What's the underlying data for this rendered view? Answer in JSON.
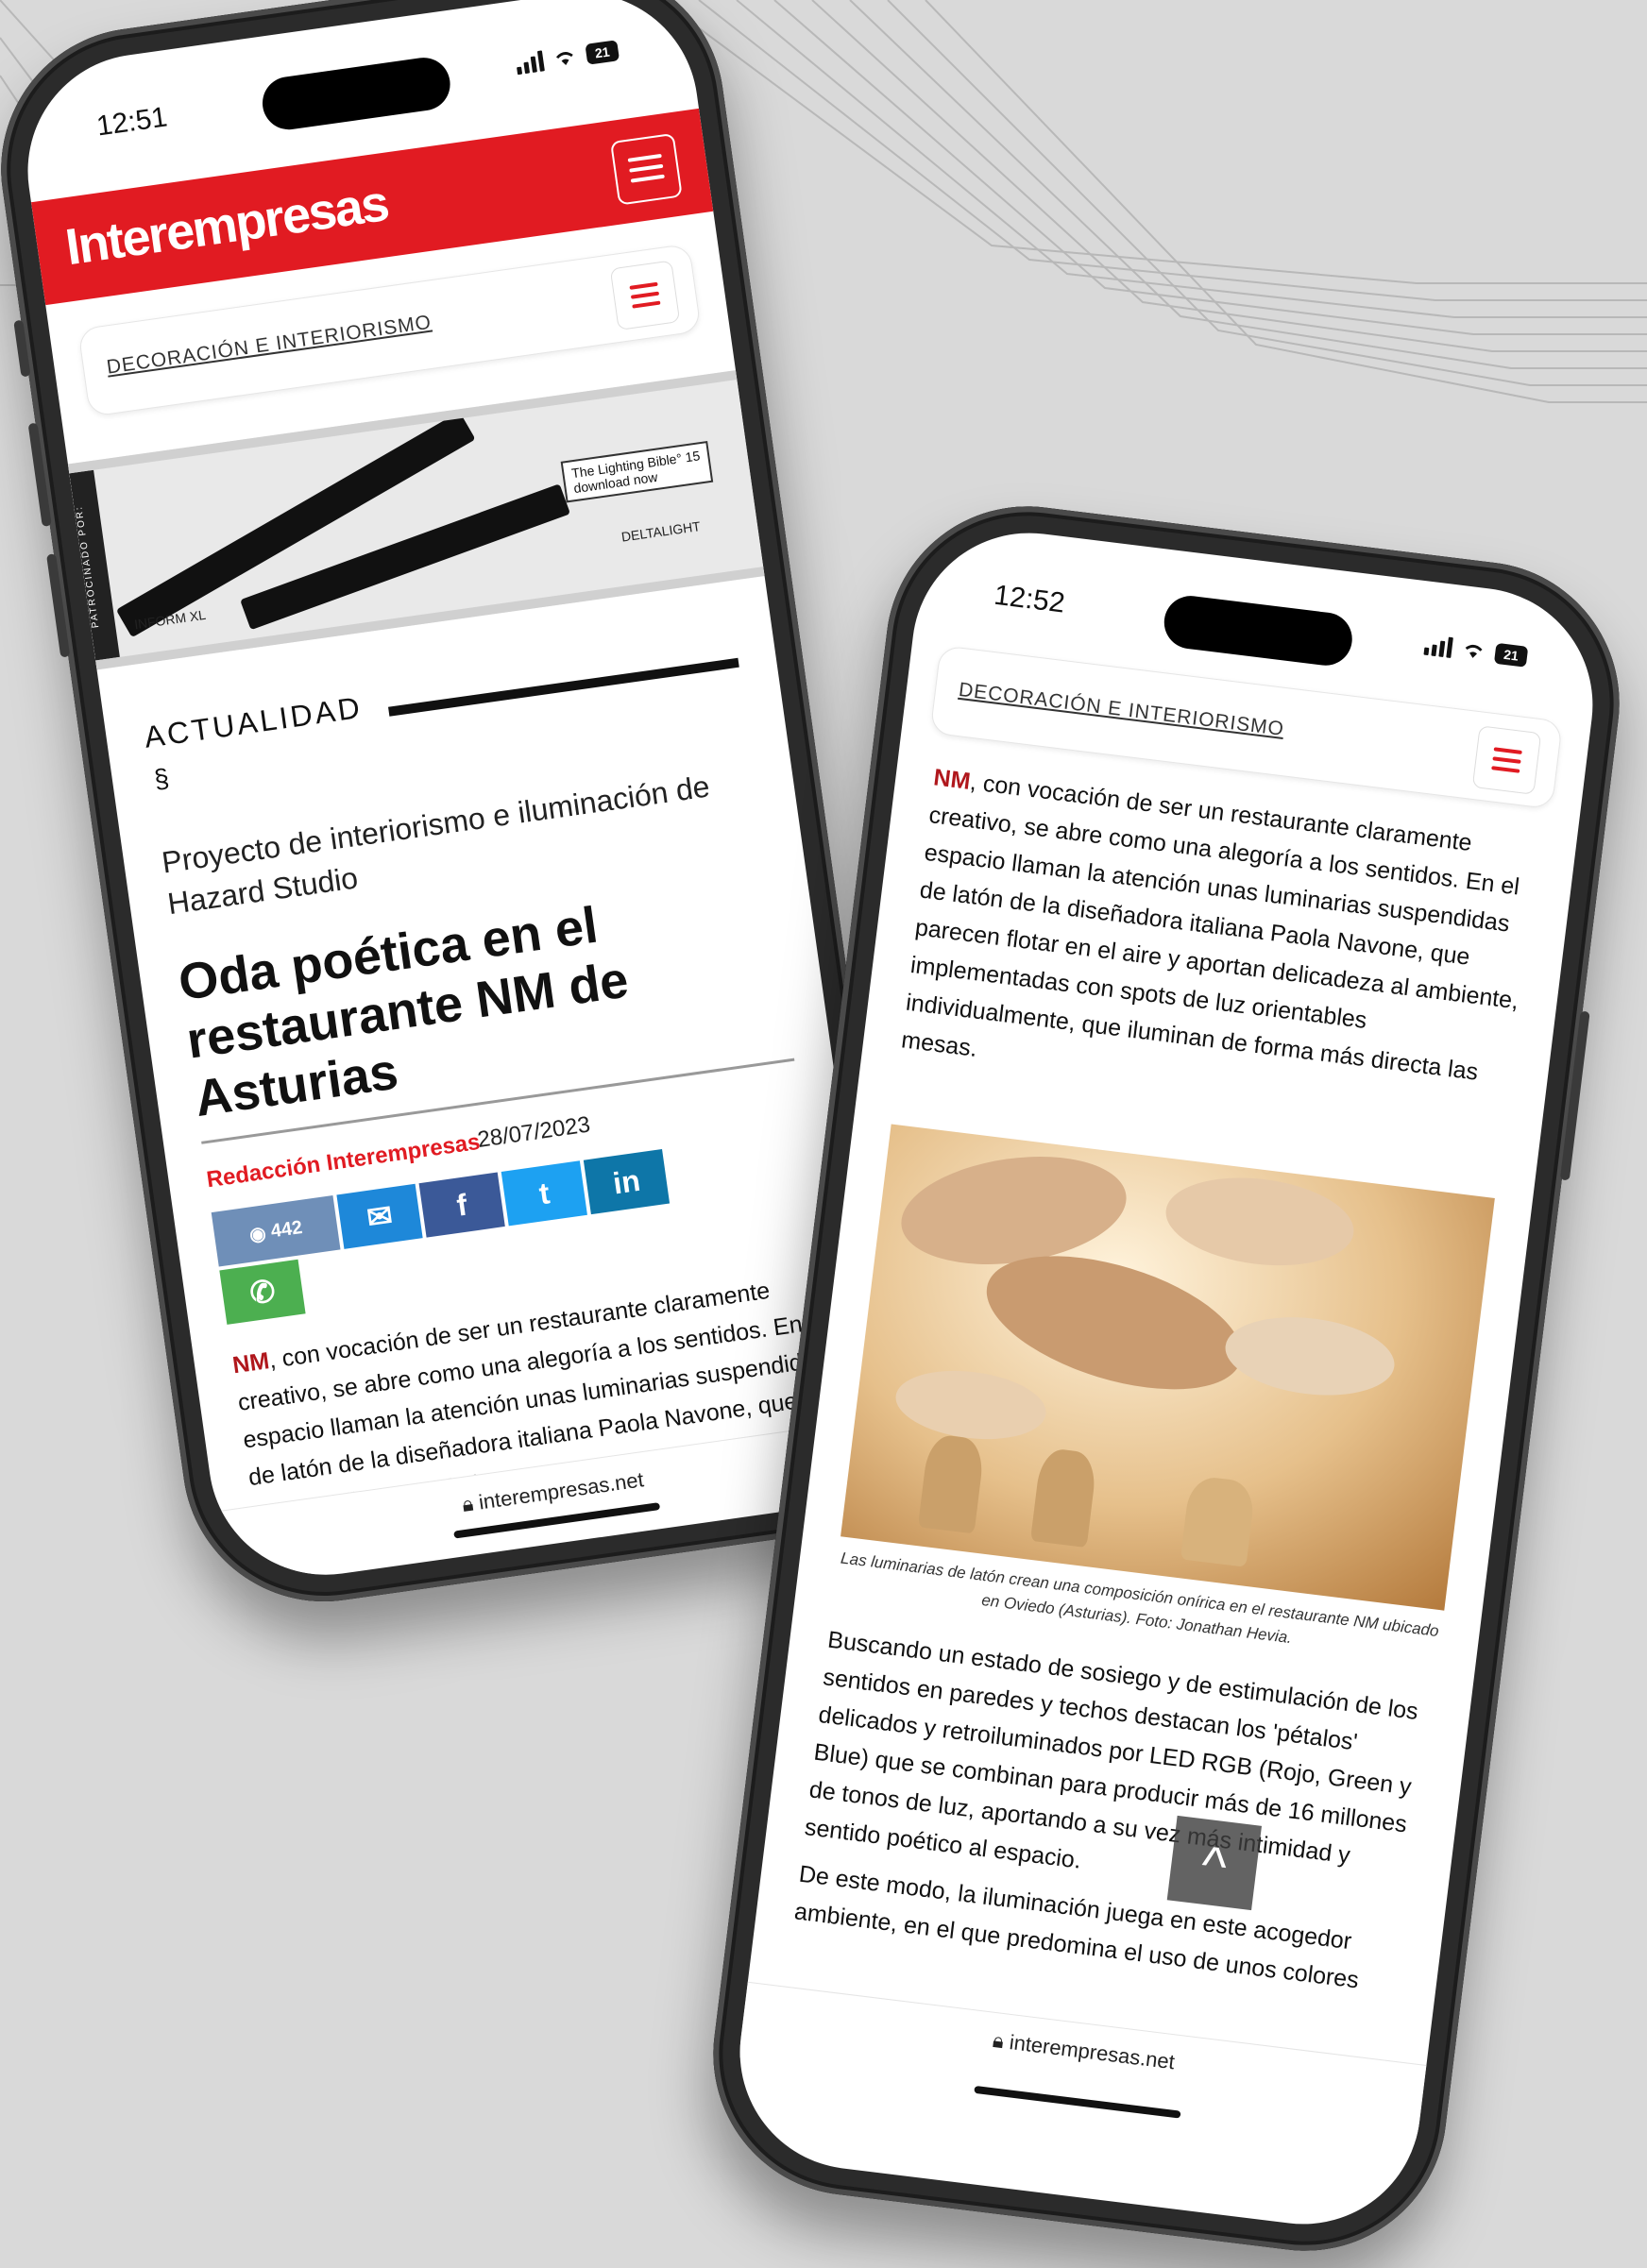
{
  "phone1": {
    "status": {
      "time": "12:51",
      "battery": "21"
    },
    "site": {
      "logo": "Interempresas"
    },
    "section": {
      "title": "DECORACIÓN E INTERIORISMO"
    },
    "ad": {
      "sponsor_tag": "PATROCINADO POR:",
      "promo_line1": "The Lighting Bible° 15",
      "promo_line2": "download now",
      "brand": "DELTALIGHT",
      "product": "INFORM XL"
    },
    "article": {
      "kicker": "ACTUALIDAD",
      "subtitle": "Proyecto de interiorismo e iluminación de Hazard Studio",
      "headline": "Oda poética en el restaurante NM de Asturias",
      "author": "Redacción Interempresas",
      "date": "28/07/2023",
      "views": "442",
      "lead_strong": "NM",
      "lead_text": ", con vocación de ser un restaurante claramente creativo, se abre como una alegoría a los sentidos. En el espacio llaman la atención unas luminarias suspendidas de latón de la diseñadora italiana Paola Navone, que parecen flotar en el aire y aportan"
    },
    "share": {
      "mail": "✉",
      "facebook": "f",
      "twitter": "t",
      "linkedin": "in",
      "whatsapp": "✆"
    },
    "url": "interempresas.net"
  },
  "phone2": {
    "status": {
      "time": "12:52",
      "battery": "21"
    },
    "section": {
      "title": "DECORACIÓN E INTERIORISMO"
    },
    "article": {
      "lead_strong": "NM",
      "lead_text": ", con vocación de ser un restaurante claramente creativo, se abre como una alegoría a los sentidos. En el espacio llaman la atención unas luminarias suspendidas de latón de la diseñadora italiana Paola Navone, que parecen flotar en el aire y aportan delicadeza al ambiente, implementadas con spots de luz orientables individualmente, que iluminan de forma más directa las mesas.",
      "caption": "Las luminarias de latón crean una composición onírica en el restaurante NM ubicado en Oviedo (Asturias). Foto: Jonathan Hevia.",
      "para2": "Buscando un estado de sosiego y de estimulación de los sentidos en paredes y techos destacan los 'pétalos' delicados y retroiluminados por LED RGB (Rojo, Green y Blue) que se combinan para producir más de 16 millones de tonos de luz, aportando a su vez más intimidad y sentido poético al espacio.",
      "para3": "De este modo, la iluminación juega en este acogedor ambiente, en el que predomina el uso de unos colores"
    },
    "back_to_top": "^",
    "url": "interempresas.net"
  },
  "colors": {
    "brand_red": "#e11b22",
    "eye": "#6f8fb8",
    "mail": "#1e88d9",
    "facebook": "#3b5998",
    "twitter": "#1da1f2",
    "linkedin": "#0e76a8",
    "whatsapp": "#4caf50"
  }
}
